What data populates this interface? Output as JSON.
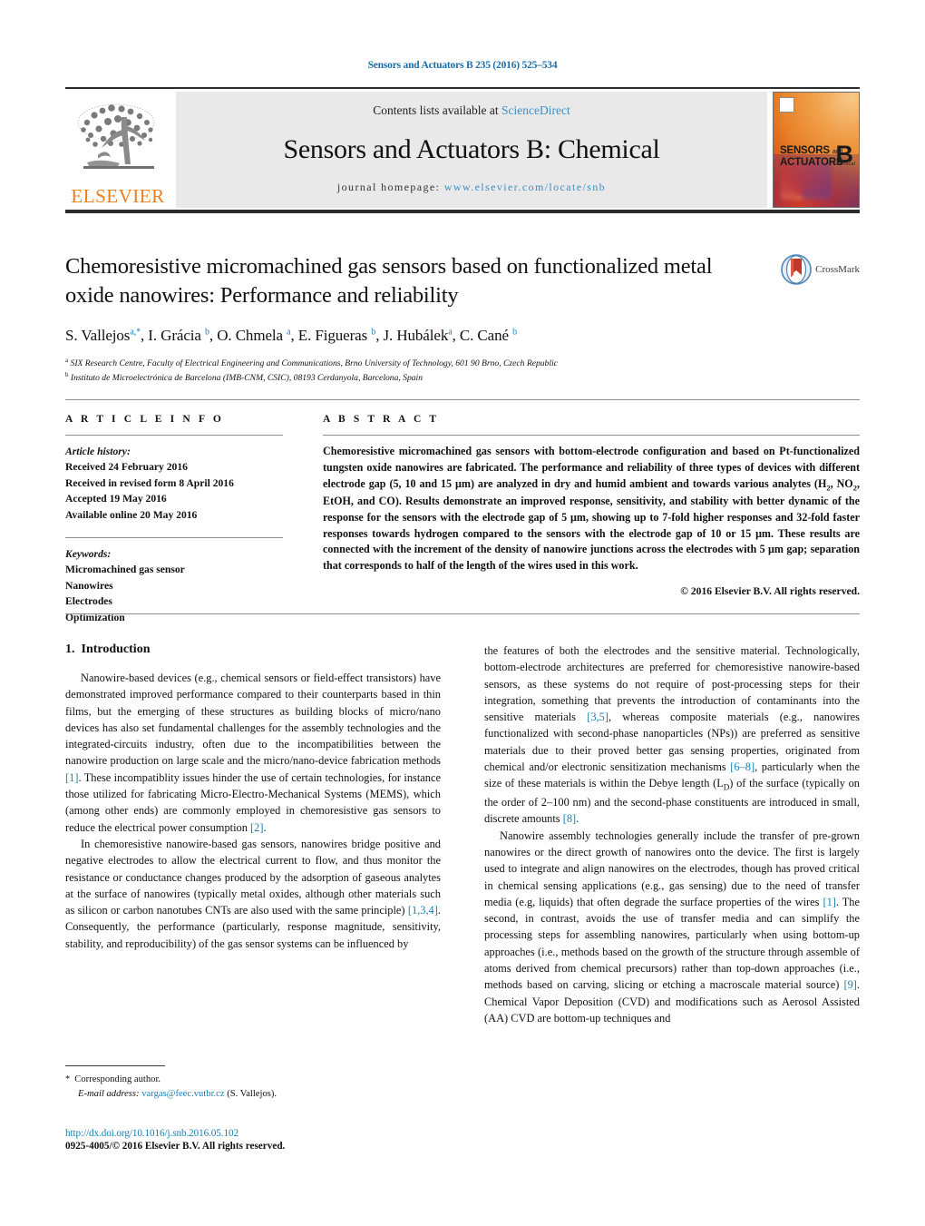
{
  "running_head": "Sensors and Actuators B 235 (2016) 525–534",
  "masthead": {
    "publisher_name": "ELSEVIER",
    "contents_prefix": "Contents lists available at ",
    "contents_link": "ScienceDirect",
    "journal_title": "Sensors and Actuators B: Chemical",
    "homepage_prefix": "journal homepage: ",
    "homepage_url": "www.elsevier.com/locate/snb",
    "cover": {
      "line1": "SENSORS",
      "and": "and",
      "line2": "ACTUATORS",
      "letter": "B",
      "sublabel": "Chemical"
    }
  },
  "article": {
    "title": "Chemoresistive micromachined gas sensors based on functionalized metal oxide nanowires: Performance and reliability",
    "crossmark_label": "CrossMark",
    "authors": [
      {
        "name": "S. Vallejos",
        "marks": "a,*"
      },
      {
        "name": "I. Grácia",
        "marks": "b"
      },
      {
        "name": "O. Chmela",
        "marks": "a"
      },
      {
        "name": "E. Figueras",
        "marks": "b"
      },
      {
        "name": "J. Hubálek",
        "marks": "a"
      },
      {
        "name": "C. Cané",
        "marks": "b"
      }
    ],
    "affiliations": [
      {
        "mark": "a",
        "text": "SIX Research Centre, Faculty of Electrical Engineering and Communications, Brno University of Technology, 601 90 Brno, Czech Republic"
      },
      {
        "mark": "b",
        "text": "Instituto de Microelectrónica de Barcelona (IMB-CNM, CSIC), 08193 Cerdanyola, Barcelona, Spain"
      }
    ]
  },
  "article_info": {
    "heading": "A R T I C L E    I N F O",
    "history_label": "Article history:",
    "history": [
      "Received 24 February 2016",
      "Received in revised form 8 April 2016",
      "Accepted 19 May 2016",
      "Available online 20 May 2016"
    ],
    "keywords_label": "Keywords:",
    "keywords": [
      "Micromachined gas sensor",
      "Nanowires",
      "Electrodes",
      "Optimization"
    ]
  },
  "abstract": {
    "heading": "A B S T R A C T",
    "paragraph_1": "Chemoresistive micromachined gas sensors with bottom-electrode configuration and based on Pt-functionalized tungsten oxide nanowires are fabricated. The performance and reliability of three types of devices with different electrode gap (5, 10 and 15 μm) are analyzed in dry and humid ambient and towards various analytes (H",
    "paragraph_1b": ", NO",
    "paragraph_1c": ", EtOH, and CO). Results demonstrate an improved response, sensitivity, and stability with better dynamic of the response for the sensors with the electrode gap of 5 μm, showing up to 7-fold higher responses and 32-fold faster responses towards hydrogen compared to the sensors with the electrode gap of 10 or 15 μm. These results are connected with the increment of the density of nanowire junctions across the electrodes with 5 μm gap; separation that corresponds to half of the length of the wires used in this work.",
    "sub_2a": "2",
    "sub_2b": "2",
    "copyright": "© 2016 Elsevier B.V. All rights reserved."
  },
  "body": {
    "section_number": "1.",
    "section_name": "Introduction",
    "left_paragraphs": [
      {
        "runs": [
          {
            "t": "Nanowire-based devices (e.g., chemical sensors or field-effect transistors) have demonstrated improved performance compared to their counterparts based in thin films, but the emerging of these structures as building blocks of micro/nano devices has also set fundamental challenges for the assembly technologies and the integrated-circuits industry, often due to the incompatibilities between the nanowire production on large scale and the micro/nano-device fabrication methods "
          },
          {
            "t": "[1]",
            "ref": true
          },
          {
            "t": ". These incompatiblity issues hinder the use of certain technologies, for instance those utilized for fabricating Micro-Electro-Mechanical Systems (MEMS), which (among other ends) are commonly employed in chemoresistive gas sensors to reduce the electrical power consumption "
          },
          {
            "t": "[2]",
            "ref": true
          },
          {
            "t": "."
          }
        ]
      },
      {
        "runs": [
          {
            "t": "In chemoresistive nanowire-based gas sensors, nanowires bridge positive and negative electrodes to allow the electrical current to flow, and thus monitor the resistance or conductance changes produced by the adsorption of gaseous analytes at the surface of nanowires (typically metal oxides, although other materials such as silicon or carbon nanotubes CNTs are also used with the same principle) "
          },
          {
            "t": "[1,3,4]",
            "ref": true
          },
          {
            "t": ". Consequently, the performance (particularly, response magnitude, sensitivity, stability, and reproducibility) of the gas sensor systems can be influenced by"
          }
        ]
      }
    ],
    "right_paragraphs": [
      {
        "continued": true,
        "runs": [
          {
            "t": "the features of both the electrodes and the sensitive material. Technologically, bottom-electrode architectures are preferred for chemoresistive nanowire-based sensors, as these systems do not require of post-processing steps for their integration, something that prevents the introduction of contaminants into the sensitive materials "
          },
          {
            "t": "[3,5]",
            "ref": true
          },
          {
            "t": ", whereas composite materials (e.g., nanowires functionalized with second-phase nanoparticles (NPs)) are preferred as sensitive materials due to their proved better gas sensing properties, originated from chemical and/or electronic sensitization mechanisms "
          },
          {
            "t": "[6–8]",
            "ref": true
          },
          {
            "t": ", particularly when the size of these materials is within the Debye length (L"
          },
          {
            "t": "D",
            "sub": true
          },
          {
            "t": ") of the surface (typically on the order of 2–100 nm) and the second-phase constituents are introduced in small, discrete amounts "
          },
          {
            "t": "[8]",
            "ref": true
          },
          {
            "t": "."
          }
        ]
      },
      {
        "runs": [
          {
            "t": "Nanowire assembly technologies generally include the transfer of pre-grown nanowires or the direct growth of nanowires onto the device. The first is largely used to integrate and align nanowires on the electrodes, though has proved critical in chemical sensing applications (e.g., gas sensing) due to the need of transfer media (e.g, liquids) that often degrade the surface properties of the wires "
          },
          {
            "t": "[1]",
            "ref": true
          },
          {
            "t": ". The second, in contrast, avoids the use of transfer media and can simplify the processing steps for assembling nanowires, particularly when using bottom-up approaches (i.e., methods based on the growth of the structure through assemble of atoms derived from chemical precursors) rather than top-down approaches (i.e., methods based on carving, slicing or etching a macroscale material source) "
          },
          {
            "t": "[9]",
            "ref": true
          },
          {
            "t": ". Chemical Vapor Deposition (CVD) and modifications such as Aerosol Assisted (AA) CVD are bottom-up techniques and"
          }
        ]
      }
    ]
  },
  "footer": {
    "corresponding_star": "*",
    "corresponding_label": "Corresponding author.",
    "email_label": "E-mail address:",
    "email": "vargas@feec.vutbr.cz",
    "email_owner": "(S. Vallejos).",
    "doi": "http://dx.doi.org/10.1016/j.snb.2016.05.102",
    "issn_line": "0925-4005/© 2016 Elsevier B.V. All rights reserved."
  },
  "colors": {
    "link_blue": "#1a7fb5",
    "elsevier_orange": "#ef7d1a",
    "band_gray": "#e9e9e9"
  }
}
